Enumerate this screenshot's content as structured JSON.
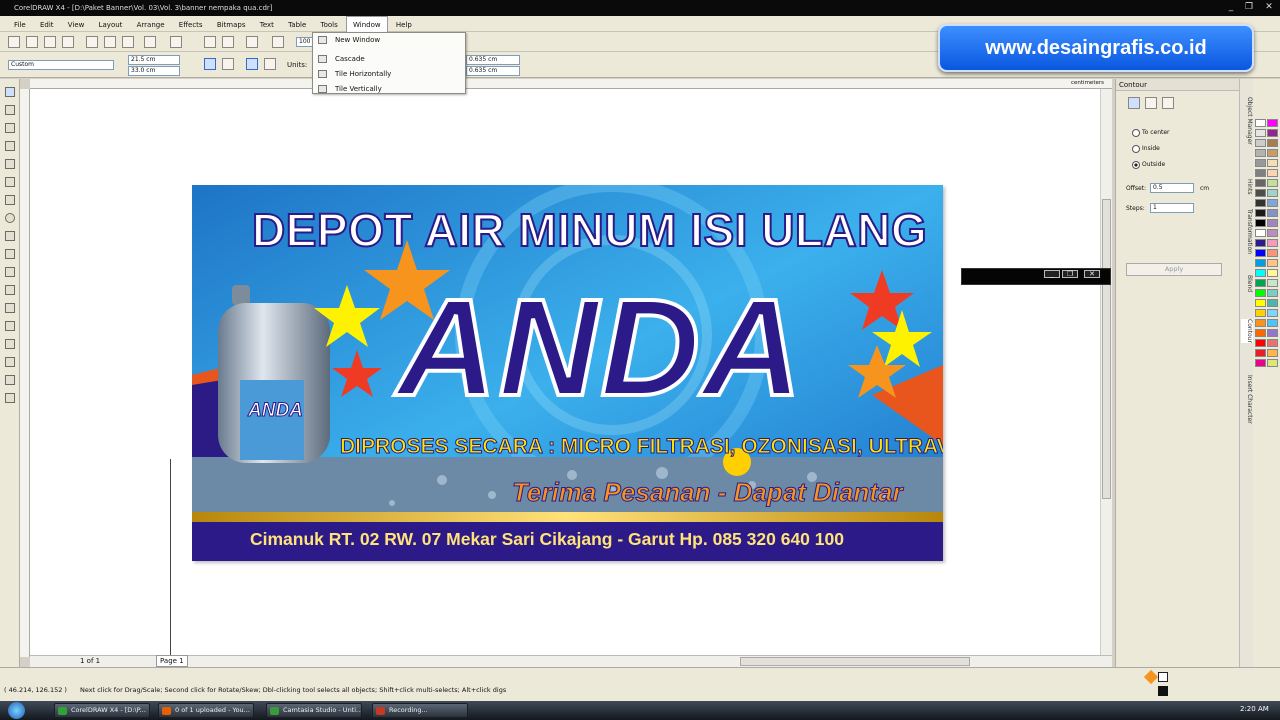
{
  "window": {
    "title": "CorelDRAW X4 - [D:\\Paket Banner\\Vol. 03\\Vol. 3\\banner nempaka qua.cdr]",
    "controls": [
      "_",
      "❐",
      "✕"
    ]
  },
  "menubar": [
    "File",
    "Edit",
    "View",
    "Layout",
    "Arrange",
    "Effects",
    "Bitmaps",
    "Text",
    "Table",
    "Tools",
    "Window",
    "Help"
  ],
  "toolbar": {
    "zoom_value": "100",
    "page_preset": "Custom",
    "width": "21.5 cm",
    "height": "33.0 cm",
    "units_label": "Units:",
    "nudge_x": "0.635 cm",
    "nudge_y": "0.635 cm",
    "ruler_units": "centimeters"
  },
  "window_menu": [
    "New Window",
    "Cascade",
    "Tile Horizontally",
    "Tile Vertically"
  ],
  "overlay": {
    "url": "www.desaingrafis.co.id"
  },
  "banner": {
    "headline": "DEPOT AIR MINUM ISI ULANG",
    "brand": "ANDA",
    "process": "DIPROSES SECARA : MICRO FILTRASI, OZONISASI, ULTRAVIOLET",
    "service": "Terima Pesanan - Dapat Diantar",
    "address": "Cimanuk RT. 02 RW. 07 Mekar Sari Cikajang - Garut Hp. 085 320 640 100",
    "label_brand": "ANDA"
  },
  "docker": {
    "title": "Contour",
    "options": [
      "To center",
      "Inside",
      "Outside"
    ],
    "selected": "Outside",
    "offset_label": "Offset:",
    "offset_value": "0.5",
    "offset_unit": "cm",
    "steps_label": "Steps:",
    "steps_value": "1",
    "apply_label": "Apply"
  },
  "side_tabs": [
    "Object Manager",
    "Hints",
    "Transformation",
    "Blend",
    "Contour",
    "Insert Character"
  ],
  "pager": {
    "count": "1 of 1",
    "page_tab": "Page 1"
  },
  "status": {
    "coords": "( 46.214, 126.152 )",
    "hint": "Next click for Drag/Scale; Second click for Rotate/Skew; Dbl-clicking tool selects all objects; Shift+click multi-selects; Alt+click digs"
  },
  "taskbar": {
    "tasks": [
      "CorelDRAW X4 - [D:\\P...",
      "0 of 1 uploaded - You...",
      "Camtasia Studio - Unti...",
      "Recording..."
    ],
    "clock": "2:20 AM"
  },
  "palette_colors": [
    "#ffffff",
    "#e6e6e6",
    "#cccccc",
    "#b3b3b3",
    "#999999",
    "#808080",
    "#666666",
    "#4d4d4d",
    "#333333",
    "#1a1a1a",
    "#000000",
    "#ffffff",
    "#2b1b8c",
    "#0000ff",
    "#00a0e9",
    "#00ffff",
    "#00a651",
    "#00ff00",
    "#ffff00",
    "#ffd200",
    "#f7941d",
    "#ff6600",
    "#ff0000",
    "#ed1c24",
    "#ec008c",
    "#ff00ff",
    "#92278f",
    "#a67c52",
    "#c69c6d",
    "#f5deb3",
    "#fbd4b4",
    "#c4df9b",
    "#9fd3c7",
    "#7da7d9",
    "#8393ca",
    "#a186be",
    "#bd8cbf",
    "#f49ac1",
    "#f69679",
    "#fdc689",
    "#fff799",
    "#c8e6c9",
    "#80cbc4",
    "#4db6ac",
    "#81d4fa",
    "#4fc3f7",
    "#9575cd",
    "#e57373",
    "#ffb74d",
    "#dce775"
  ]
}
